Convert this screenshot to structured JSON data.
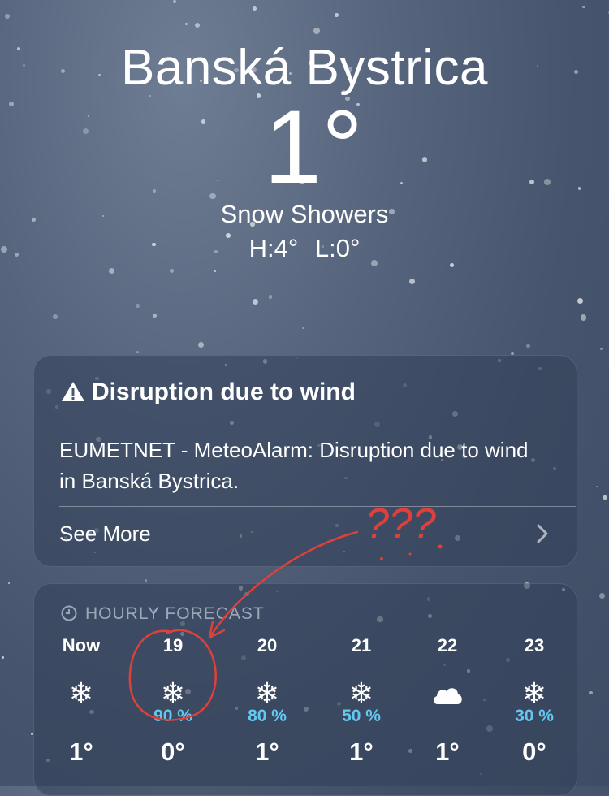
{
  "location": {
    "city": "Banská Bystrica",
    "temperature": "1°",
    "condition": "Snow Showers",
    "high": "H:4°",
    "low": "L:0°"
  },
  "alert": {
    "title": "Disruption due to wind",
    "body": "EUMETNET - MeteoAlarm: Disruption due to wind in Banská Bystrica.",
    "see_more": "See More"
  },
  "hourly": {
    "header": "HOURLY FORECAST",
    "hours": [
      {
        "time": "Now",
        "icon": "snowflake-icon",
        "precip": "",
        "temp": "1°"
      },
      {
        "time": "19",
        "icon": "snowflake-icon",
        "precip": "90 %",
        "temp": "0°"
      },
      {
        "time": "20",
        "icon": "snowflake-icon",
        "precip": "80 %",
        "temp": "1°"
      },
      {
        "time": "21",
        "icon": "snowflake-icon",
        "precip": "50 %",
        "temp": "1°"
      },
      {
        "time": "22",
        "icon": "cloud-icon",
        "precip": "",
        "temp": "1°"
      },
      {
        "time": "23",
        "icon": "snowflake-icon",
        "precip": "30 %",
        "temp": "0°"
      }
    ]
  },
  "annotation": {
    "text": "???",
    "color": "#e0403a"
  },
  "colors": {
    "precip": "#63c8ef",
    "annotation": "#e0403a"
  }
}
